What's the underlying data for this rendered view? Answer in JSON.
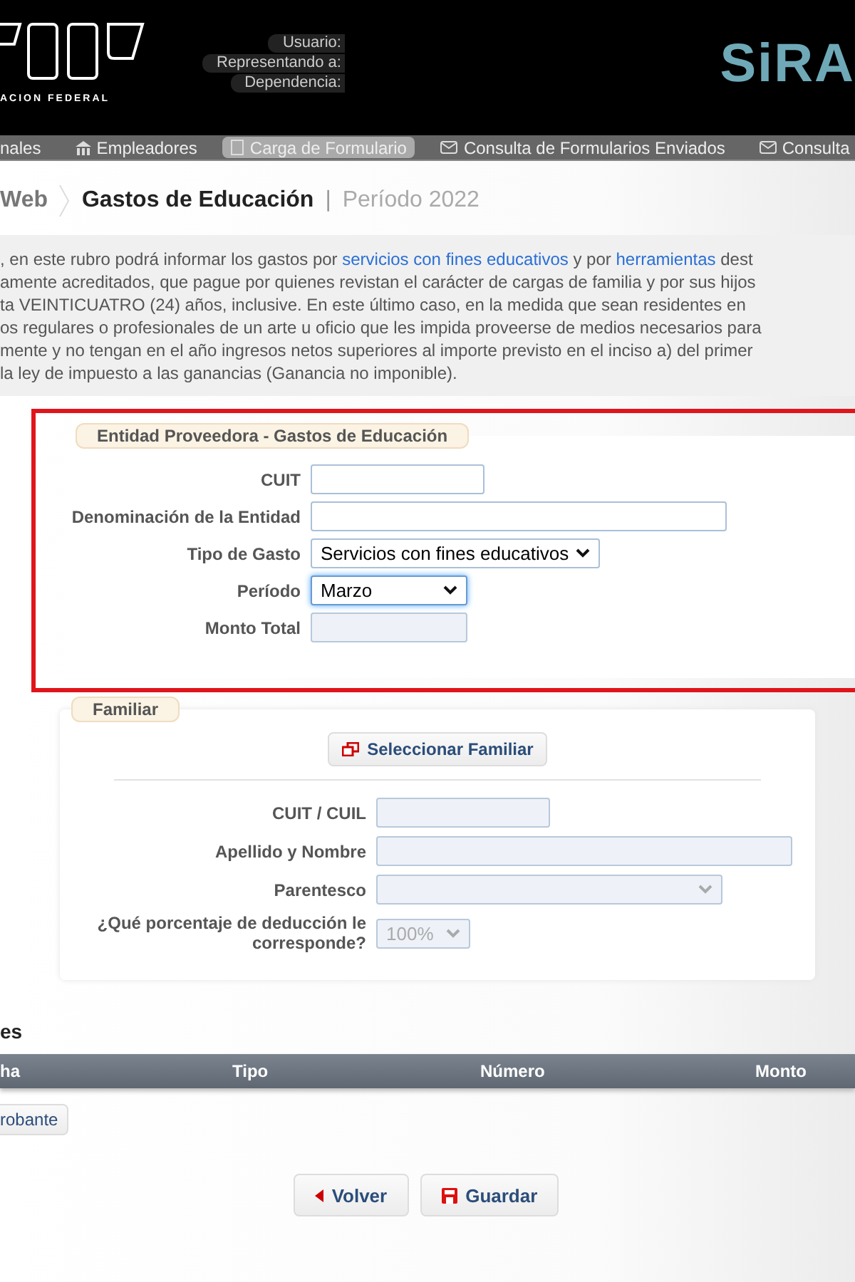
{
  "header": {
    "org_caption": "ACION FEDERAL",
    "user_labels": [
      "Usuario:",
      "Representando a:",
      "Dependencia:"
    ],
    "app_name": "SiRA"
  },
  "nav": [
    {
      "label": "nales",
      "selected": false
    },
    {
      "label": "Empleadores",
      "selected": false
    },
    {
      "label": "Carga de Formulario",
      "selected": true
    },
    {
      "label": "Consulta de Formularios Enviados",
      "selected": false
    },
    {
      "label": "Consulta",
      "selected": false
    }
  ],
  "breadcrumb": {
    "parent": "Web",
    "title": "Gastos de Educación",
    "separator": "|",
    "period": "Período 2022"
  },
  "description": [
    [
      {
        "text": ", en este rubro podrá informar los gastos por ",
        "link": false
      },
      {
        "text": "servicios con fines educativos",
        "link": true
      },
      {
        "text": " y por ",
        "link": false
      },
      {
        "text": "herramientas",
        "link": true
      },
      {
        "text": " dest",
        "link": false
      }
    ],
    [
      {
        "text": "amente acreditados, que pague por quienes revistan el carácter de cargas de familia y por sus hijos",
        "link": false
      }
    ],
    [
      {
        "text": "ta VEINTICUATRO (24) años, inclusive. En este último caso, en la medida que sean residentes en",
        "link": false
      }
    ],
    [
      {
        "text": "os regulares o profesionales de un arte u oficio que les impida proveerse de medios necesarios para",
        "link": false
      }
    ],
    [
      {
        "text": "mente y no tengan en el año ingresos netos superiores al importe previsto en el inciso a) del primer",
        "link": false
      }
    ],
    [
      {
        "text": "la ley de impuesto a las ganancias (Ganancia no imponible).",
        "link": false
      }
    ]
  ],
  "entidad": {
    "legend": "Entidad Proveedora - Gastos de Educación",
    "highlighted": true,
    "fields": [
      {
        "label": "CUIT",
        "kind": "input",
        "disabled": false,
        "focused": false
      },
      {
        "label": "Denominación de la Entidad",
        "kind": "input",
        "disabled": false,
        "focused": false
      },
      {
        "label": "Tipo de Gasto",
        "kind": "select",
        "value": "Servicios con fines educativos",
        "disabled": false,
        "focused": false
      },
      {
        "label": "Período",
        "kind": "select",
        "value": "Marzo",
        "disabled": false,
        "focused": true
      },
      {
        "label": "Monto Total",
        "kind": "input",
        "disabled": true,
        "focused": false
      }
    ]
  },
  "familiar": {
    "legend": "Familiar",
    "select_button": "Seleccionar Familiar",
    "fields": [
      {
        "label": "CUIT / CUIL",
        "kind": "input",
        "disabled": true,
        "focused": false
      },
      {
        "label": "Apellido y Nombre",
        "kind": "input",
        "disabled": true,
        "focused": false
      },
      {
        "label": "Parentesco",
        "kind": "select",
        "disabled": true,
        "focused": false
      },
      {
        "label": "¿Qué porcentaje de deducción le corresponde?",
        "kind": "select",
        "value": "100%",
        "disabled": true,
        "focused": false
      }
    ]
  },
  "comprobantes": {
    "heading": "es",
    "columns": [
      "ha",
      "Tipo",
      "Número",
      "Monto"
    ],
    "add_button": "robante"
  },
  "buttons": [
    {
      "label": "Volver"
    },
    {
      "label": "Guardar"
    }
  ]
}
